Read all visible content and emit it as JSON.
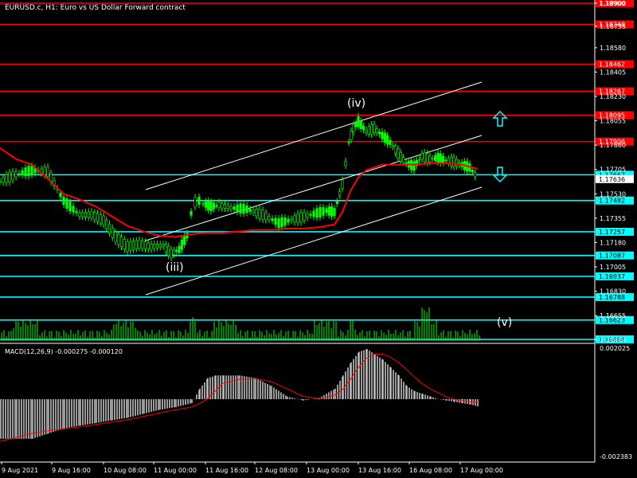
{
  "chart_data": {
    "type": "line",
    "title": "EURUSD.c, H1:  Euro vs US Dollar Forward contract",
    "price_axis": {
      "min": 1.16484,
      "max": 1.189,
      "ticks": [
        "1.18900",
        "1.18735",
        "1.18580",
        "1.18405",
        "1.18230",
        "1.18055",
        "1.17880",
        "1.17705",
        "1.17530",
        "1.17355",
        "1.17180",
        "1.17005",
        "1.16830",
        "1.16655",
        "1.16484"
      ]
    },
    "time_axis": {
      "labels": [
        "9 Aug 2021",
        "9 Aug 16:00",
        "10 Aug 08:00",
        "11 Aug 00:00",
        "11 Aug 16:00",
        "12 Aug 08:00",
        "13 Aug 00:00",
        "13 Aug 16:00",
        "16 Aug 08:00",
        "17 Aug 00:00"
      ]
    },
    "horizontal_levels": [
      {
        "price": 1.189,
        "label": "1.18900",
        "color": "#ff0000"
      },
      {
        "price": 1.18748,
        "label": "1.18748",
        "color": "#ff0000"
      },
      {
        "price": 1.18462,
        "label": "1.18462",
        "color": "#ff0000"
      },
      {
        "price": 1.18267,
        "label": "1.18267",
        "color": "#ff0000"
      },
      {
        "price": 1.18095,
        "label": "1.18095",
        "color": "#ff0000"
      },
      {
        "price": 1.17906,
        "label": "1.17906",
        "color": "#ff0000"
      },
      {
        "price": 1.17667,
        "label": "1.17667",
        "color": "#00ffff"
      },
      {
        "price": 1.17482,
        "label": "1.17482",
        "color": "#00ffff"
      },
      {
        "price": 1.17257,
        "label": "1.17257",
        "color": "#00ffff"
      },
      {
        "price": 1.17087,
        "label": "1.17087",
        "color": "#00ffff"
      },
      {
        "price": 1.16937,
        "label": "1.16937",
        "color": "#00ffff"
      },
      {
        "price": 1.16788,
        "label": "1.16788",
        "color": "#00ffff"
      },
      {
        "price": 1.16623,
        "label": "1.16623",
        "color": "#00ffff"
      },
      {
        "price": 1.16484,
        "label": "1.16484",
        "color": "#00ffff"
      }
    ],
    "current_price": {
      "label": "1.17636"
    },
    "series": [
      {
        "x": [
          0,
          20,
          40,
          60,
          80,
          100,
          115,
          130,
          145,
          160,
          175,
          190,
          205,
          215,
          225,
          235,
          240,
          245,
          250,
          255,
          265,
          275,
          290,
          310,
          330,
          350,
          370,
          390,
          410,
          420,
          430,
          438,
          444,
          450,
          460,
          470,
          480,
          490,
          500,
          510,
          520,
          530,
          540,
          550,
          560,
          570,
          580,
          590,
          600
        ],
        "y": [
          1.1762,
          1.1767,
          1.177,
          1.1769,
          1.1748,
          1.1738,
          1.1738,
          1.1734,
          1.1722,
          1.1715,
          1.1717,
          1.1715,
          1.1716,
          1.171,
          1.1713,
          1.1723,
          1.1739,
          1.1747,
          1.1748,
          1.1746,
          1.1744,
          1.1745,
          1.1743,
          1.1742,
          1.1738,
          1.1732,
          1.1735,
          1.1738,
          1.1741,
          1.174,
          1.176,
          1.179,
          1.18,
          1.1805,
          1.1798,
          1.18,
          1.1795,
          1.179,
          1.1782,
          1.1775,
          1.1773,
          1.178,
          1.1778,
          1.1779,
          1.1777,
          1.1776,
          1.1774,
          1.1772,
          1.1764
        ]
      },
      {
        "name": "",
        "color": "#ff0000",
        "x": [
          0,
          20,
          40,
          60,
          80,
          100,
          120,
          140,
          160,
          180,
          200,
          220,
          240,
          260,
          280,
          300,
          320,
          340,
          360,
          380,
          400,
          420,
          430,
          440,
          450,
          460,
          470,
          480,
          500,
          520,
          540,
          560,
          580,
          600
        ],
        "y": [
          1.1786,
          1.1778,
          1.1774,
          1.1764,
          1.1753,
          1.1749,
          1.1744,
          1.1737,
          1.173,
          1.1726,
          1.1723,
          1.1722,
          1.1724,
          1.1725,
          1.1725,
          1.1726,
          1.1727,
          1.1727,
          1.1728,
          1.1728,
          1.1729,
          1.1731,
          1.174,
          1.1755,
          1.1765,
          1.177,
          1.1772,
          1.1774,
          1.1774,
          1.1774,
          1.1775,
          1.1775,
          1.1774,
          1.1771
        ]
      }
    ],
    "wave_labels": [
      {
        "text": "(iv)"
      },
      {
        "text": "(iii)"
      },
      {
        "text": "(v)"
      }
    ],
    "macd": {
      "label": "MACD(12,26,9) -0.000275 -0.000120",
      "axis_top": "0.002025",
      "axis_bottom": "-0.002383",
      "min": -0.002383,
      "max": 0.002025,
      "hist_x": [
        0,
        20,
        40,
        60,
        80,
        100,
        120,
        140,
        160,
        180,
        200,
        220,
        240,
        250,
        260,
        270,
        280,
        300,
        320,
        340,
        360,
        380,
        400,
        420,
        430,
        440,
        450,
        460,
        470,
        480,
        490,
        500,
        510,
        520,
        530,
        540,
        550,
        560,
        570,
        580,
        590,
        600
      ],
      "hist": [
        -0.0015,
        -0.0015,
        -0.0015,
        -0.0013,
        -0.0011,
        -0.001,
        -0.0009,
        -0.0008,
        -0.0007,
        -0.00055,
        -0.0004,
        -0.0003,
        -0.00015,
        0.0004,
        0.0008,
        0.0009,
        0.0009,
        0.0009,
        0.0008,
        0.0005,
        0.0001,
        -5e-05,
        5e-05,
        0.0004,
        0.0009,
        0.0014,
        0.0018,
        0.0019,
        0.0017,
        0.0015,
        0.0012,
        0.0009,
        0.0005,
        0.0003,
        0.0002,
        0.0001,
        0.0,
        -5e-05,
        -0.0001,
        -0.00015,
        -0.0002,
        -0.00028
      ],
      "signal": [
        -0.0016,
        -0.00145,
        -0.0013,
        -0.0012,
        -0.00112,
        -0.00105,
        -0.00096,
        -0.00087,
        -0.00078,
        -0.00065,
        -0.00052,
        -0.0004,
        -0.0003,
        -0.00018,
        0.0,
        0.0003,
        0.0006,
        0.00075,
        0.00078,
        0.00068,
        0.0004,
        0.00012,
        2e-05,
        0.00015,
        0.00035,
        0.00075,
        0.0012,
        0.00155,
        0.0017,
        0.00172,
        0.0016,
        0.0014,
        0.00115,
        0.00085,
        0.0006,
        0.0004,
        0.00025,
        0.0001,
        0.0,
        -5e-05,
        -0.0001,
        -0.00012
      ]
    }
  }
}
